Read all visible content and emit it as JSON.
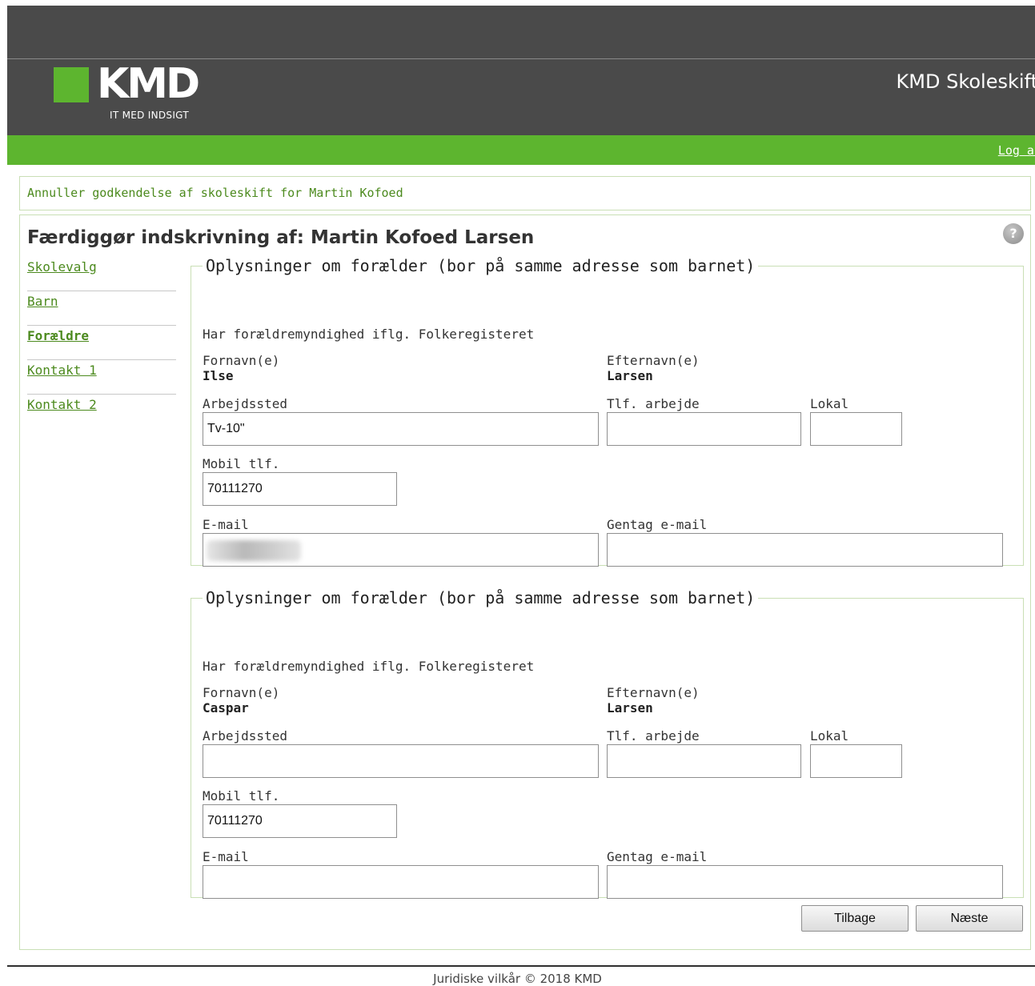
{
  "header": {
    "logo_text": "KMD",
    "logo_tagline": "IT MED INDSIGT",
    "app_title": "KMD Skoleskift",
    "logout_label": "Log af"
  },
  "cancel_link": "Annuller godkendelse af skoleskift for Martin Kofoed",
  "page_title": "Færdiggør indskrivning af: Martin Kofoed Larsen",
  "help_icon": "?",
  "sidebar": {
    "items": [
      {
        "label": "Skolevalg"
      },
      {
        "label": "Barn"
      },
      {
        "label": "Forældre"
      },
      {
        "label": "Kontakt 1"
      },
      {
        "label": "Kontakt 2"
      }
    ]
  },
  "parents": [
    {
      "legend": "Oplysninger om forælder (bor på samme adresse som barnet)",
      "custody_note": "Har forældremyndighed iflg. Folkeregisteret",
      "firstname_label": "Fornavn(e)",
      "firstname": "Ilse",
      "lastname_label": "Efternavn(e)",
      "lastname": "Larsen",
      "workplace_label": "Arbejdssted",
      "workplace_value": "Tv-10\"",
      "workphone_label": "Tlf. arbejde",
      "workphone_value": "",
      "ext_label": "Lokal",
      "ext_value": "",
      "mobile_label": "Mobil tlf.",
      "mobile_value": "70111270",
      "email_label": "E-mail",
      "email_value": "",
      "email_repeat_label": "Gentag e-mail",
      "email_repeat_value": ""
    },
    {
      "legend": "Oplysninger om forælder (bor på samme adresse som barnet)",
      "custody_note": "Har forældremyndighed iflg. Folkeregisteret",
      "firstname_label": "Fornavn(e)",
      "firstname": "Caspar",
      "lastname_label": "Efternavn(e)",
      "lastname": "Larsen",
      "workplace_label": "Arbejdssted",
      "workplace_value": "",
      "workphone_label": "Tlf. arbejde",
      "workphone_value": "",
      "ext_label": "Lokal",
      "ext_value": "",
      "mobile_label": "Mobil tlf.",
      "mobile_value": "70111270",
      "email_label": "E-mail",
      "email_value": "",
      "email_repeat_label": "Gentag e-mail",
      "email_repeat_value": ""
    }
  ],
  "buttons": {
    "back": "Tilbage",
    "next": "Næste"
  },
  "footer": "Juridiske vilkår © 2018 KMD",
  "colors": {
    "brand_green": "#5db52f",
    "header_dark": "#4a4a4a",
    "link_green": "#4c8a1e"
  }
}
